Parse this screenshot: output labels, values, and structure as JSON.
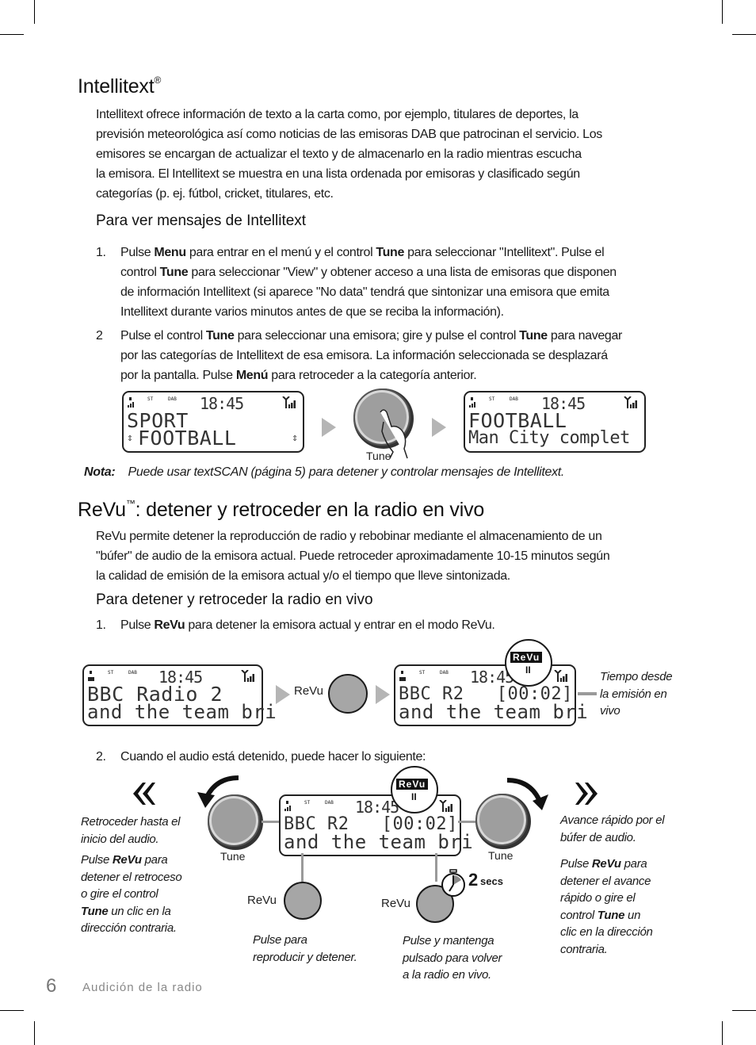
{
  "intellitext": {
    "title": "Intellitext",
    "title_mark": "®",
    "paragraph_lines": [
      "Intellitext ofrece información de texto a la carta como, por ejemplo, titulares de deportes, la",
      "previsión meteorológica así como noticias de las emisoras DAB que patrocinan el servicio. Los",
      "emisores se encargan de actualizar el texto y de almacenarlo en la radio mientras escucha",
      "la emisora. El Intellitext se muestra en una lista ordenada por emisoras y clasificado según",
      "categorías (p. ej. fútbol, cricket, titulares, etc."
    ],
    "subheading": "Para ver mensajes de Intellitext",
    "steps": [
      {
        "number": "1.",
        "lines": [
          [
            "Pulse ",
            "Menu",
            " para entrar en el menú y el control ",
            "Tune",
            " para seleccionar \"Intellitext\". Pulse el"
          ],
          [
            "control ",
            "Tune",
            " para seleccionar \"View\" y obtener acceso a una lista de emisoras que disponen"
          ],
          [
            "de información Intellitext (si aparece \"No data\" tendrá que sintonizar una emisora que emita"
          ],
          [
            "Intellitext durante varios minutos antes de que se reciba la información)."
          ]
        ]
      },
      {
        "number": "2",
        "lines": [
          [
            "Pulse el control ",
            "Tune",
            " para seleccionar una emisora; gire y pulse el control ",
            "Tune",
            " para navegar"
          ],
          [
            "por las categorías de Intellitext de esa emisora. La información seleccionada se desplazará"
          ],
          [
            "por la pantalla. Pulse ",
            "Menú",
            " para retroceder a la categoría anterior."
          ]
        ]
      }
    ],
    "display_1": {
      "st": "ST",
      "dab": "DAB",
      "time": "18:45",
      "line1": "SPORT",
      "line2": "FOOTBALL"
    },
    "knob_label": "Tune",
    "display_2": {
      "st": "ST",
      "dab": "DAB",
      "time": "18:45",
      "line1": "FOOTBALL",
      "line2": "Man City complet"
    },
    "note_label": "Nota:",
    "note_text": "Puede usar textSCAN (página 5) para detener y controlar mensajes de Intellitext."
  },
  "revu": {
    "title": "ReVu",
    "title_mark": "™",
    "title_rest": ": detener y retroceder en la radio en vivo",
    "paragraph_lines": [
      "ReVu permite detener la reproducción de radio y rebobinar mediante el almacenamiento de un",
      "\"búfer\" de audio de la emisora actual. Puede retroceder aproximadamente 10-15 minutos según",
      "la calidad de emisión de la emisora actual y/o el tiempo que lleve sintonizada."
    ],
    "subheading": "Para detener y retroceder la radio en vivo",
    "step1": {
      "number": "1.",
      "parts": [
        "Pulse ",
        "ReVu",
        " para detener la emisora actual y entrar en el modo ReVu."
      ]
    },
    "display_a": {
      "st": "ST",
      "dab": "DAB",
      "time": "18:45",
      "line1": "BBC Radio 2",
      "line2": "and the team bri"
    },
    "button_label": "ReVu",
    "display_b": {
      "st": "ST",
      "dab": "DAB",
      "time": "18:45",
      "line1": "BBC R2   [00:02]",
      "line2": "and the team bri"
    },
    "badge_label": "ReVu",
    "badge_pause": "II",
    "callout_lines": [
      "Tiempo desde",
      "la emisión en",
      "vivo"
    ],
    "step2": {
      "number": "2.",
      "text": "Cuando el audio está detenido, puede hacer lo siguiente:"
    },
    "display_c": {
      "st": "ST",
      "dab": "DAB",
      "time": "18:45",
      "line1": "BBC R2   [00:02]",
      "line2": "and the team bri"
    },
    "rewind": {
      "icon": "rewind-icon",
      "desc_lines": [
        "Retroceder hasta el",
        "inicio del audio."
      ],
      "help": [
        [
          "Pulse ",
          "ReVu",
          " para"
        ],
        [
          "detener el retroceso"
        ],
        [
          "o gire el control"
        ],
        [
          "",
          "Tune",
          " un clic en la"
        ],
        [
          "dirección contraria."
        ]
      ]
    },
    "forward": {
      "icon": "fast-forward-icon",
      "desc_lines": [
        "Avance rápido por el",
        "búfer de audio."
      ],
      "help": [
        [
          "Pulse ",
          "ReVu",
          " para"
        ],
        [
          "detener el avance"
        ],
        [
          "rápido o gire el"
        ],
        [
          "control ",
          "Tune",
          " un"
        ],
        [
          "clic en la dirección"
        ],
        [
          "contraria."
        ]
      ]
    },
    "tune_left_label": "Tune",
    "tune_right_label": "Tune",
    "revu_left_label": "ReVu",
    "revu_right_label": "ReVu",
    "timer_label": "2",
    "timer_unit": "secs",
    "revu_left_desc": [
      "Pulse para",
      "reproducir y detener."
    ],
    "revu_right_desc": [
      "Pulse y mantenga",
      "pulsado para volver",
      "a la radio en vivo."
    ]
  },
  "footer": {
    "page_number": "6",
    "section": "Audición de la radio"
  }
}
